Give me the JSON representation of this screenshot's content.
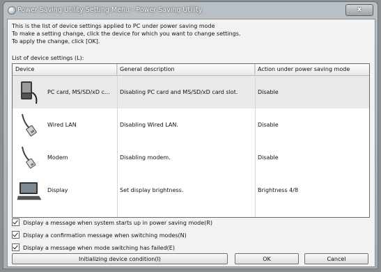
{
  "window": {
    "title": "Power Saving Utility Setting Menu - Power Saving Utility",
    "close_label": "x"
  },
  "intro": {
    "line1": "This is the list of device settings applied to PC under power saving mode",
    "line2": "To make a setting change, click the device for which you want to change settings.",
    "line3": "To apply the change, click [OK]."
  },
  "list": {
    "label": "List of device settings (L):",
    "columns": [
      "Device",
      "General description",
      "Action under power saving mode"
    ],
    "rows": [
      {
        "icon": "pc-card-icon",
        "device": "PC card, MS/SD/xD c...",
        "description": "Disabling PC card and MS/SD/xD card slot.",
        "action": "Disable",
        "selected": true
      },
      {
        "icon": "network-cable-icon",
        "device": "Wired LAN",
        "description": "Disabling Wired LAN.",
        "action": "Disable",
        "selected": false
      },
      {
        "icon": "modem-cable-icon",
        "device": "Modem",
        "description": "Disabling modem.",
        "action": "Disable",
        "selected": false
      },
      {
        "icon": "laptop-display-icon",
        "device": "Display",
        "description": "Set display brightness.",
        "action": "Brightness 4/8",
        "selected": false
      }
    ]
  },
  "options": [
    {
      "label": "Display a message when system starts up in power saving mode(R)",
      "checked": true
    },
    {
      "label": "Display a confirmation message when switching modes(N)",
      "checked": true
    },
    {
      "label": "Display a message when mode switching has failed(E)",
      "checked": true
    }
  ],
  "buttons": {
    "init": "Initializing device condition(I)",
    "ok": "OK",
    "cancel": "Cancel"
  }
}
